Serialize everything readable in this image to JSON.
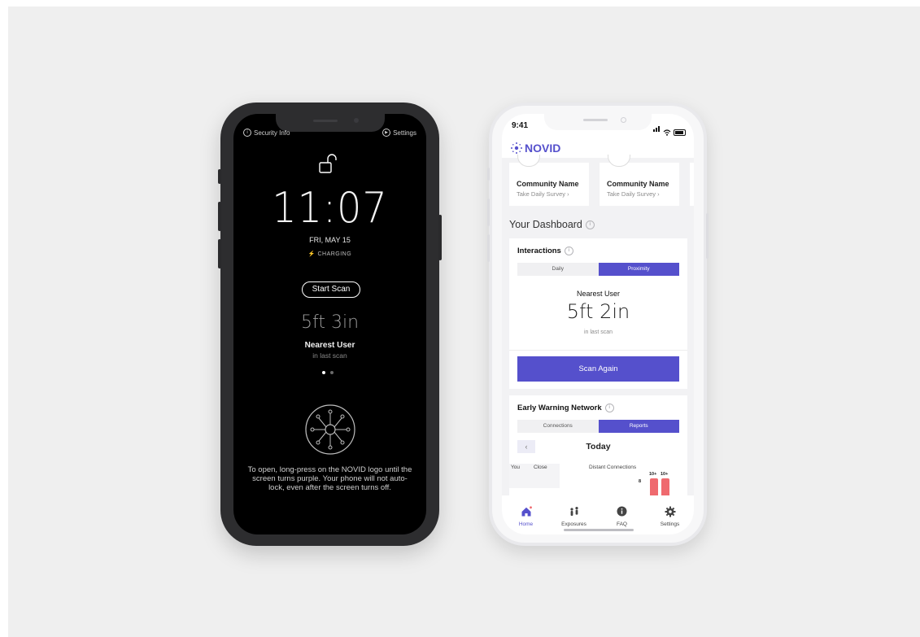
{
  "lock_screen": {
    "security_info": "Security Info",
    "settings": "Settings",
    "time": "11:07",
    "date": "FRI, MAY 15",
    "charging": "⚡ CHARGING",
    "start_scan": "Start Scan",
    "distance": "5ft 3in",
    "nearest_label": "Nearest User",
    "nearest_sub": "in last scan",
    "hint": "To open, long-press on the NOVID logo until the screen turns purple. Your phone will not auto-lock, even after the screen turns off."
  },
  "app": {
    "status_time": "9:41",
    "brand": "NOVID",
    "accent": "#5550cc",
    "communities": [
      {
        "name": "Community Name",
        "action": "Take Daily Survey ›"
      },
      {
        "name": "Community Name",
        "action": "Take Daily Survey ›"
      }
    ],
    "dashboard_title": "Your Dashboard",
    "interactions": {
      "title": "Interactions",
      "tabs": [
        "Daily",
        "Proximity"
      ],
      "active_tab": "Proximity",
      "nearest_label": "Nearest User",
      "nearest_value": "5ft 2in",
      "nearest_sub": "in last scan",
      "scan_button": "Scan Again"
    },
    "ewn": {
      "title": "Early Warning Network",
      "tabs": [
        "Connections",
        "Reports"
      ],
      "active_tab": "Reports",
      "prev_icon": "‹",
      "period": "Today",
      "col_you": "You",
      "col_close": "Close",
      "col_distant": "Distant Connections",
      "counts": [
        "8",
        "10+",
        "10+"
      ],
      "bar_color": "#ef6a6f"
    },
    "tabs": [
      {
        "label": "Home",
        "icon": "home-icon"
      },
      {
        "label": "Exposures",
        "icon": "people-icon"
      },
      {
        "label": "FAQ",
        "icon": "info-icon"
      },
      {
        "label": "Settings",
        "icon": "gear-icon"
      }
    ],
    "active_nav": "Home"
  }
}
